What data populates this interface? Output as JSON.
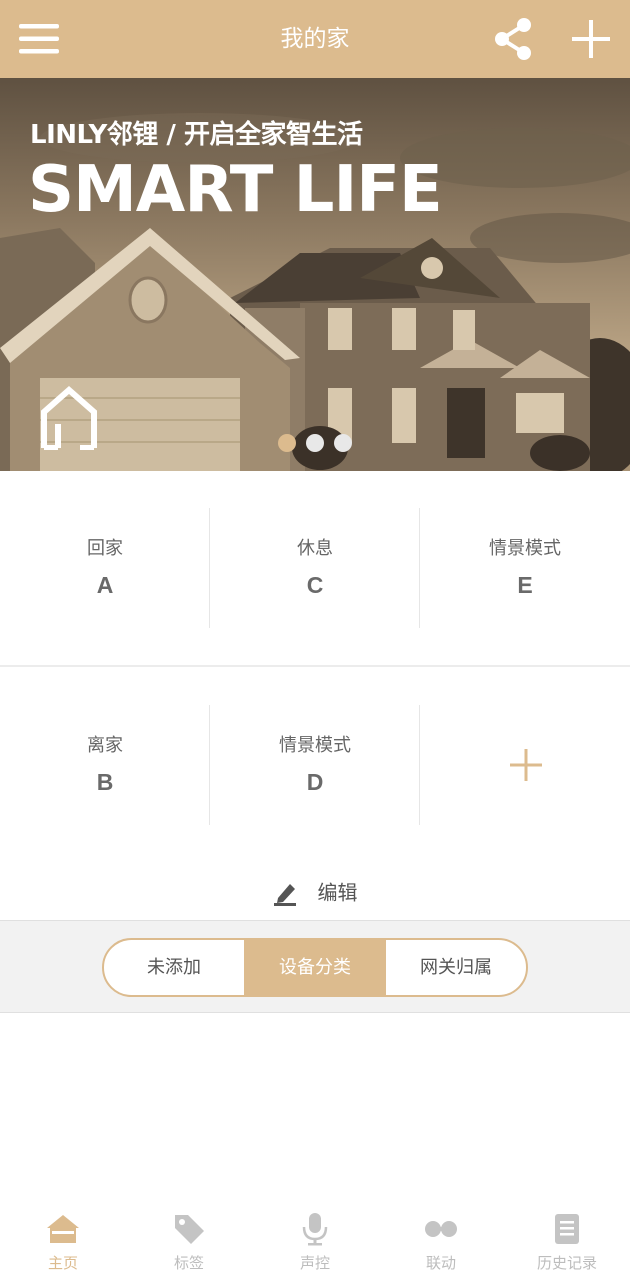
{
  "header": {
    "title": "我的家",
    "menu_icon": "menu-icon",
    "share_icon": "share-icon",
    "add_icon": "plus-icon"
  },
  "banner": {
    "brand_line": "LINLY邻锂 / 开启全家智生活",
    "headline": "SMART LIFE",
    "logo_icon": "house-outline-icon",
    "carousel": {
      "total": 3,
      "active_index": 0
    }
  },
  "scenes": [
    {
      "label": "回家",
      "letter": "A"
    },
    {
      "label": "休息",
      "letter": "C"
    },
    {
      "label": "情景模式",
      "letter": "E"
    },
    {
      "label": "离家",
      "letter": "B"
    },
    {
      "label": "情景模式",
      "letter": "D"
    }
  ],
  "add_scene_icon": "plus-icon",
  "edit": {
    "label": "编辑",
    "icon": "pencil-icon"
  },
  "segment": {
    "tabs": [
      "未添加",
      "设备分类",
      "网关归属"
    ],
    "active_index": 1
  },
  "bottom_nav": {
    "items": [
      {
        "label": "主页",
        "icon": "home-icon"
      },
      {
        "label": "标签",
        "icon": "tag-icon"
      },
      {
        "label": "声控",
        "icon": "microphone-icon"
      },
      {
        "label": "联动",
        "icon": "link-icon"
      },
      {
        "label": "历史记录",
        "icon": "document-icon"
      }
    ],
    "active_index": 0
  },
  "colors": {
    "accent": "#dcbb8e",
    "text": "#555555",
    "inactive": "#bdbdbd"
  }
}
